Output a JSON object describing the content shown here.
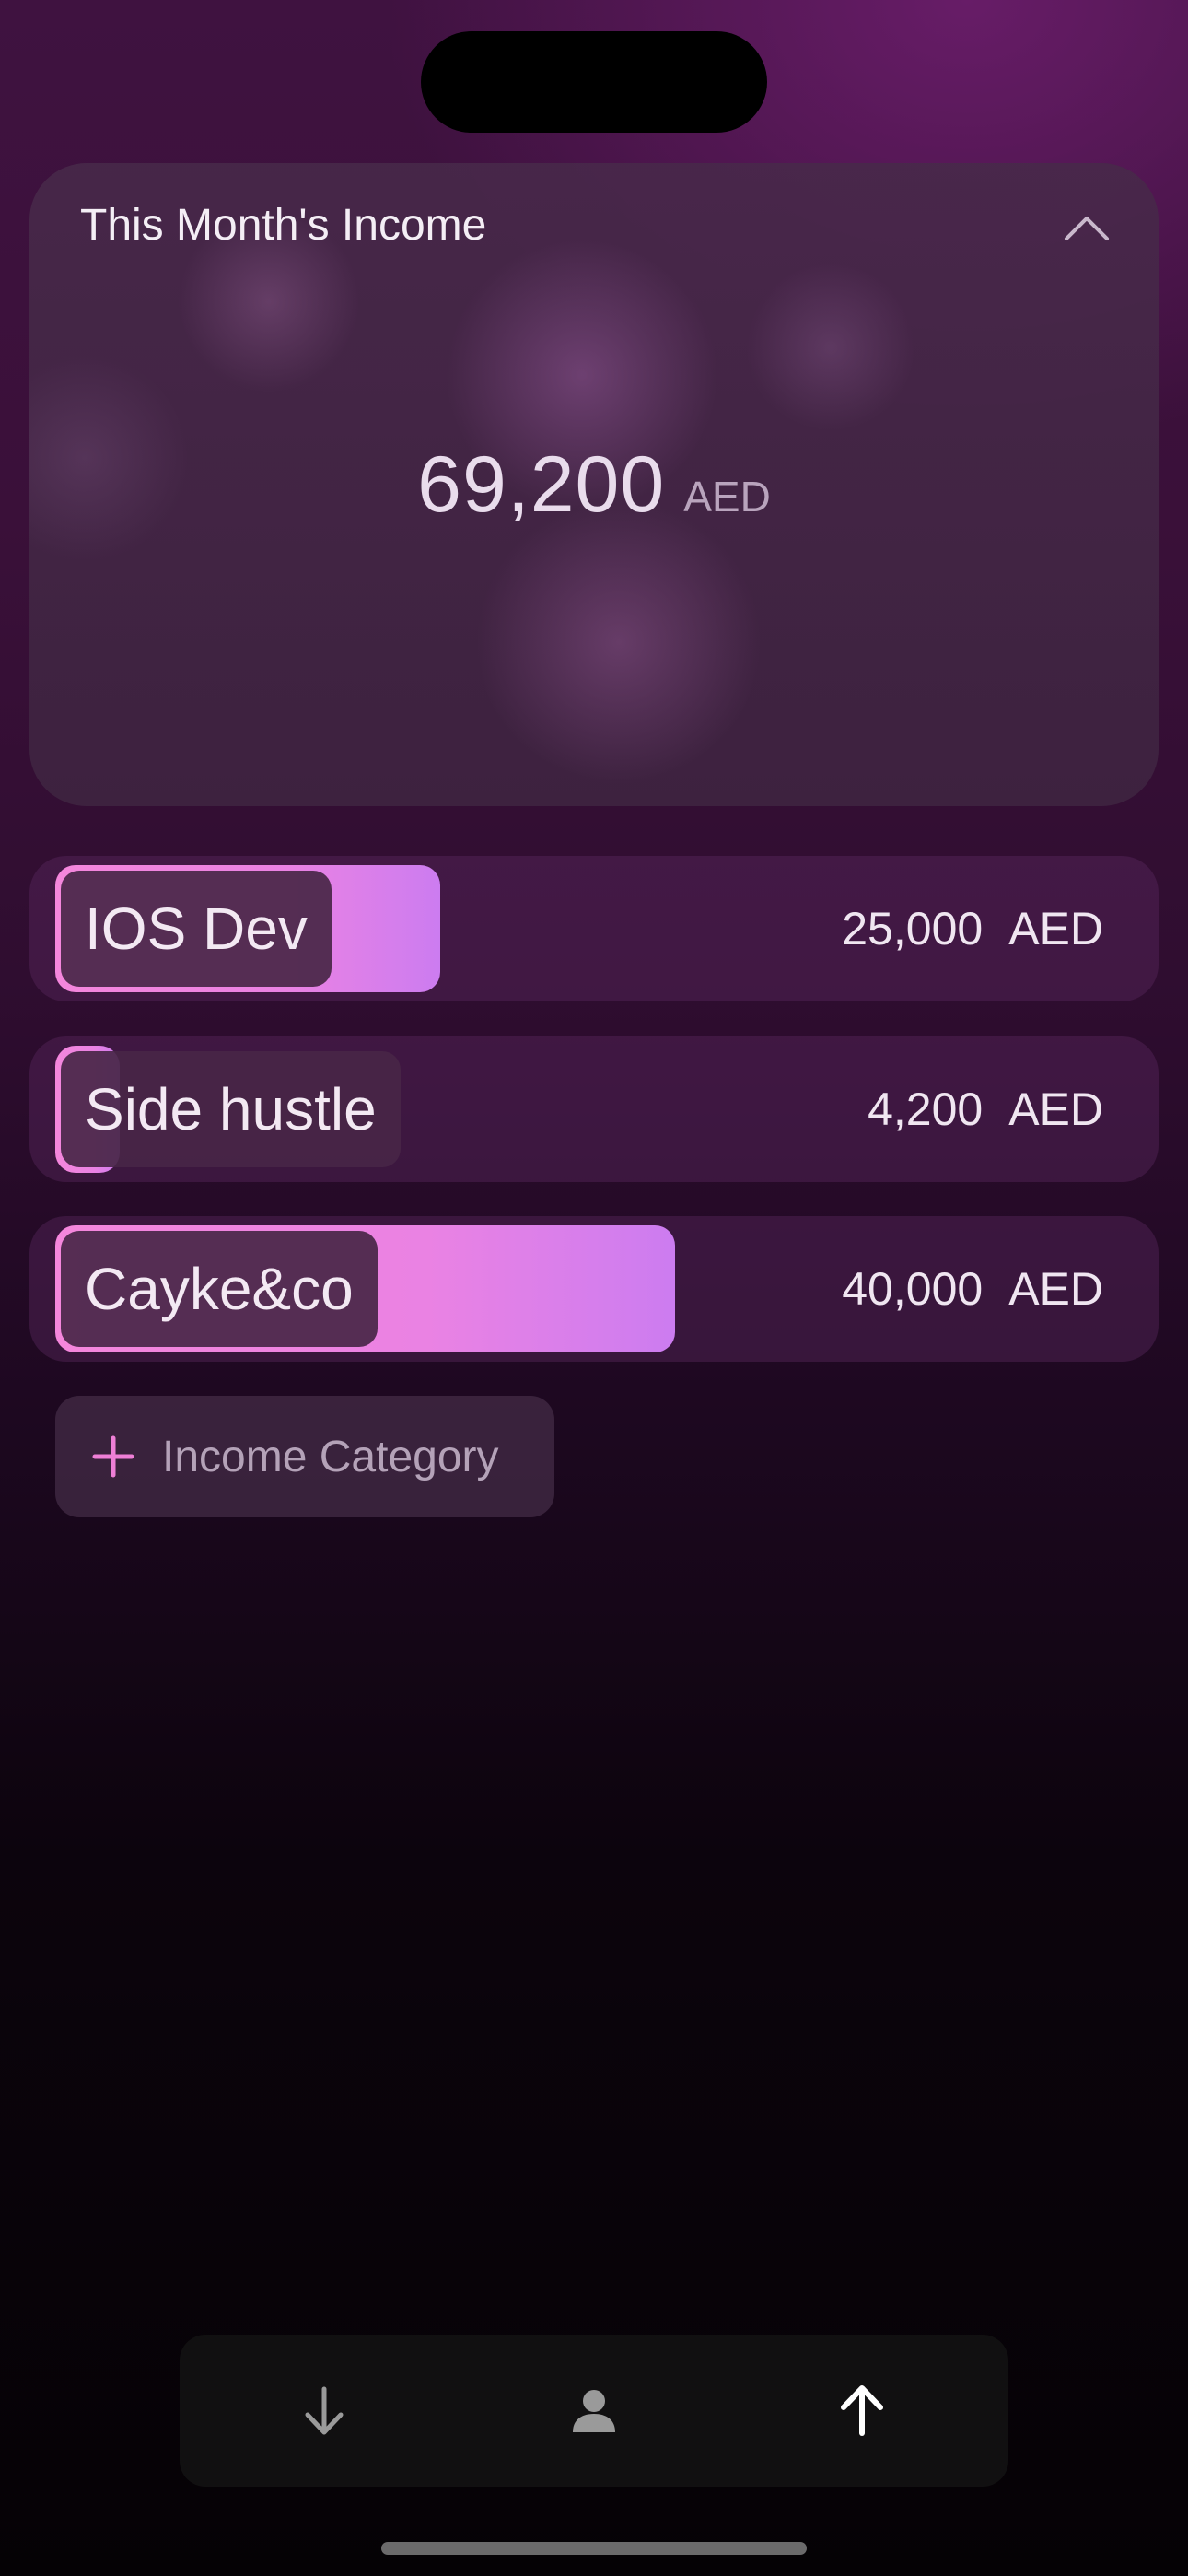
{
  "income_card": {
    "title": "This Month's Income",
    "total_amount": "69,200",
    "total_currency": "AED",
    "collapse_icon": "chevron-up-icon"
  },
  "categories": [
    {
      "name": "IOS Dev",
      "amount": "25,000",
      "currency": "AED",
      "share": 0.36
    },
    {
      "name": "Side hustle",
      "amount": "4,200",
      "currency": "AED",
      "share": 0.06
    },
    {
      "name": "Cayke&co",
      "amount": "40,000",
      "currency": "AED",
      "share": 0.58
    }
  ],
  "add_category": {
    "label": "Income Category",
    "icon": "plus-icon"
  },
  "tab_bar": {
    "tabs": [
      {
        "icon": "arrow-down-icon",
        "active": false
      },
      {
        "icon": "person-icon",
        "active": false
      },
      {
        "icon": "arrow-up-icon",
        "active": true
      }
    ]
  },
  "colors": {
    "accent_pink": "#f486dc",
    "accent_purple": "#cc7cf0",
    "background_top": "#3f1240",
    "background_bottom": "#050205"
  }
}
